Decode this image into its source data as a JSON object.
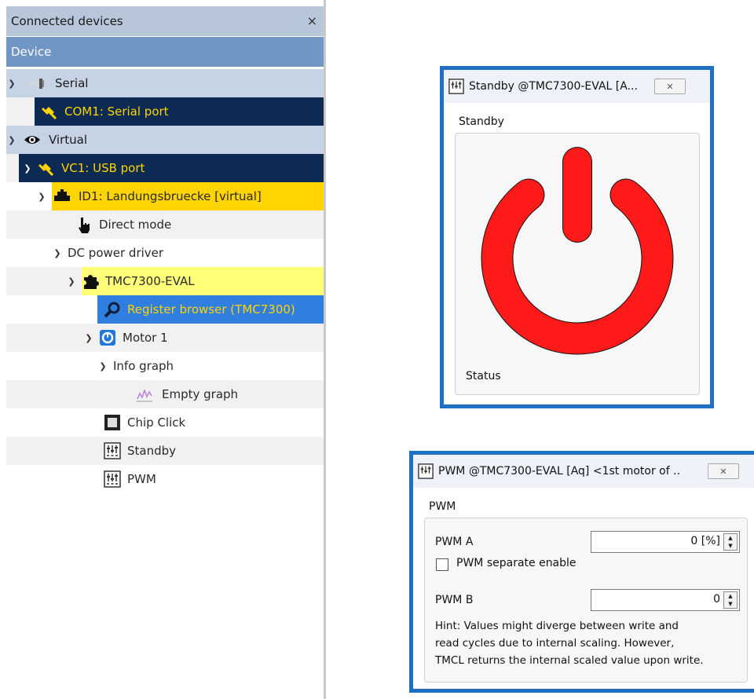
{
  "panel": {
    "title": "Connected devices",
    "close": "×",
    "column_header": "Device"
  },
  "tree": {
    "serial": "Serial",
    "com1": "COM1: Serial port",
    "virtual": "Virtual",
    "vc1": "VC1: USB port",
    "id1": "ID1: Landungsbruecke [virtual]",
    "direct_mode": "Direct mode",
    "dc_power_driver": "DC power driver",
    "tmc7300_eval": "TMC7300-EVAL",
    "register_browser": "Register browser (TMC7300)",
    "motor1": "Motor 1",
    "info_graph": "Info graph",
    "empty_graph": "Empty graph",
    "chip_click": "Chip Click",
    "standby": "Standby",
    "pwm": "PWM"
  },
  "standby_window": {
    "title": "Standby @TMC7300-EVAL [A...",
    "section_label": "Standby",
    "status_label": "Status"
  },
  "pwm_window": {
    "title": "PWM @TMC7300-EVAL [Aq] <1st motor of ..",
    "group_label": "PWM",
    "pwm_a_label": "PWM A",
    "pwm_a_value": "0 [%]",
    "separate_label": "PWM separate enable",
    "pwm_b_label": "PWM B",
    "pwm_b_value": "0",
    "hint_line1": "Hint: Values might diverge between write and",
    "hint_line2": "read cycles due to internal scaling. However,",
    "hint_line3": "TMCL returns the internal scaled value upon write."
  },
  "colors": {
    "header": "#b7c6d9",
    "column_header": "#6f96c4",
    "dark_row": "#0d2a52",
    "yellow_row": "#ffd400",
    "light_yellow_row": "#ffff7a",
    "selected_row": "#2f7ee0",
    "power_icon": "#ff1a1a",
    "window_border": "#1f6fc4"
  },
  "icons": {
    "serial": "serial-connector-icon",
    "com1": "yellow-plug-icon",
    "virtual": "eye-icon",
    "vc1": "yellow-plug-icon",
    "id1": "board-icon",
    "direct_mode": "hand-pointer-icon",
    "tmc7300_eval": "puzzle-piece-icon",
    "register_browser": "magnifier-icon",
    "motor1": "motor-icon",
    "empty_graph": "graph-icon",
    "chip_click": "chip-icon",
    "standby": "sliders-icon",
    "pwm": "sliders-icon",
    "power": "power-icon"
  }
}
